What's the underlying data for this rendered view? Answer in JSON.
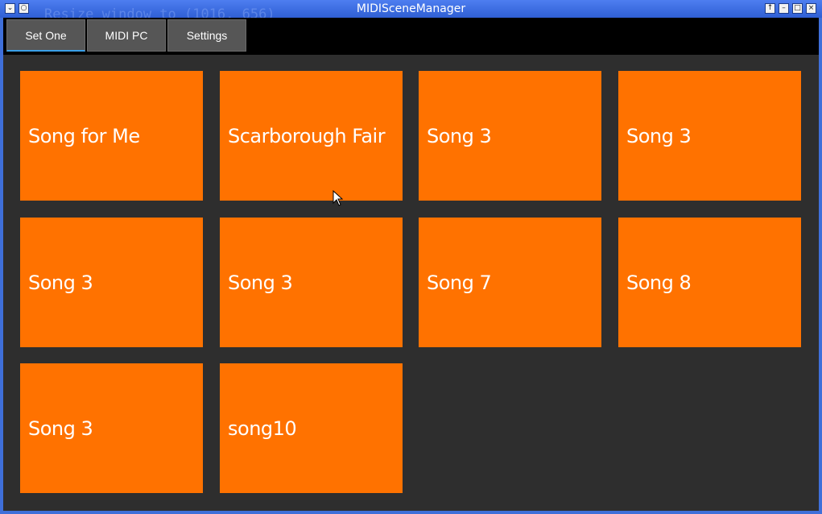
{
  "window": {
    "title": "MIDISceneManager",
    "ghost_text_top": "Resize window to (1016, 656)",
    "ghost_text_bottom": "Resize window to (1016, 656)",
    "controls_left": [
      "menu-icon",
      "sticky-icon"
    ],
    "controls_right": [
      "shade-icon",
      "minimize-icon",
      "maximize-icon",
      "close-icon"
    ]
  },
  "tabs": [
    {
      "label": "Set One",
      "active": true
    },
    {
      "label": "MIDI PC",
      "active": false
    },
    {
      "label": "Settings",
      "active": false
    }
  ],
  "songs": [
    "Song for Me",
    "Scarborough Fair",
    "Song 3",
    "Song 3",
    "Song 3",
    "Song 3",
    "Song 7",
    "Song 8",
    "Song 3",
    "song10"
  ],
  "colors": {
    "tile": "#ff7200",
    "background": "#2e2e2e",
    "titlebar": "#3f6fd9",
    "tab_indicator": "#3aa0e8"
  }
}
